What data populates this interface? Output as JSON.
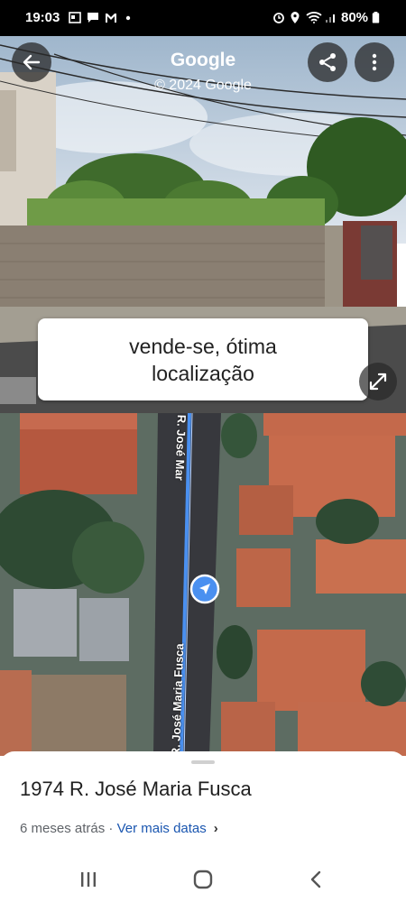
{
  "status_bar": {
    "time": "19:03",
    "battery": "80%",
    "left_icons": [
      "gallery-icon",
      "message-icon",
      "gmail-icon",
      "dot-icon"
    ],
    "right_icons": [
      "alarm-icon",
      "location-icon",
      "wifi-icon",
      "signal-icon",
      "battery-icon"
    ]
  },
  "street_view": {
    "title": "Google",
    "copyright": "© 2024 Google",
    "sign_line1": "vende-se, ótima",
    "sign_line2": "localização"
  },
  "map": {
    "street_label_top": "R. José Mar",
    "street_label_bottom": "R. José Maria Fusca",
    "accent_color": "#4a90f0"
  },
  "sheet": {
    "address": "1974 R. José Maria Fusca",
    "date_text": "6 meses atrás",
    "separator": " · ",
    "more_dates_link": "Ver mais datas",
    "chevron": "›"
  },
  "nav_bar": {
    "buttons": [
      "recents-icon",
      "home-icon",
      "back-icon"
    ]
  }
}
